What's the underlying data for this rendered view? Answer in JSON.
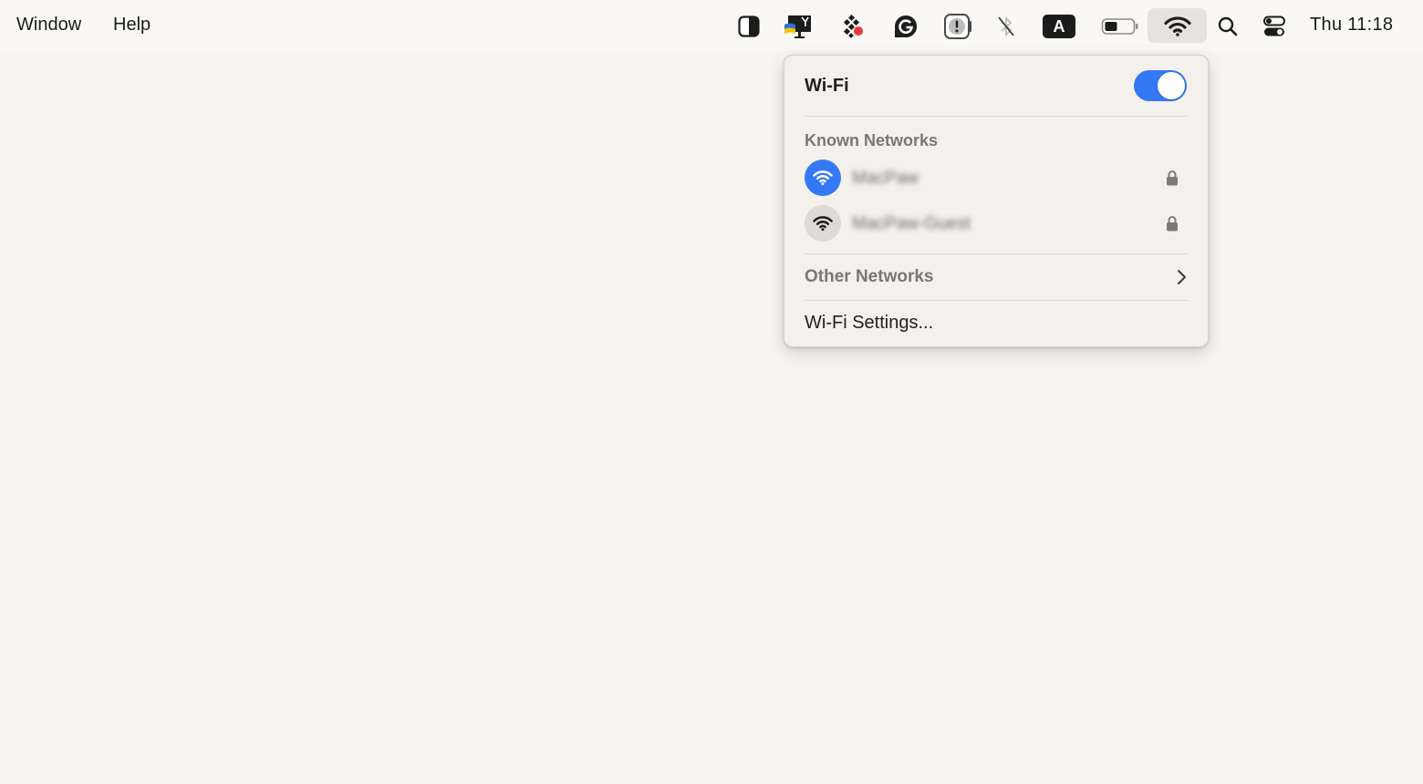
{
  "menubar": {
    "menus": [
      {
        "label": "Window"
      },
      {
        "label": "Help"
      }
    ],
    "status_icons": [
      {
        "name": "contrast-icon"
      },
      {
        "name": "monitor-ukraine-flag-icon"
      },
      {
        "name": "dots-grid-notification-icon"
      },
      {
        "name": "grammarly-icon"
      },
      {
        "name": "alert-badge-icon"
      },
      {
        "name": "bluetooth-off-icon"
      },
      {
        "name": "keyboard-input-a-icon",
        "label": "A"
      },
      {
        "name": "battery-icon"
      },
      {
        "name": "wifi-icon",
        "active": true
      },
      {
        "name": "spotlight-search-icon"
      },
      {
        "name": "control-center-icon"
      }
    ],
    "clock": "Thu 11:18"
  },
  "wifi_panel": {
    "title": "Wi-Fi",
    "toggle_on": true,
    "known_networks_label": "Known Networks",
    "known_networks": [
      {
        "name": "MacPaw",
        "connected": true,
        "secured": true
      },
      {
        "name": "MacPaw-Guest",
        "connected": false,
        "secured": true
      }
    ],
    "other_networks_label": "Other Networks",
    "settings_label": "Wi-Fi Settings..."
  },
  "colors": {
    "accent": "#3478f6",
    "background": "#f8f5f1",
    "panel": "#f4f1ed"
  }
}
